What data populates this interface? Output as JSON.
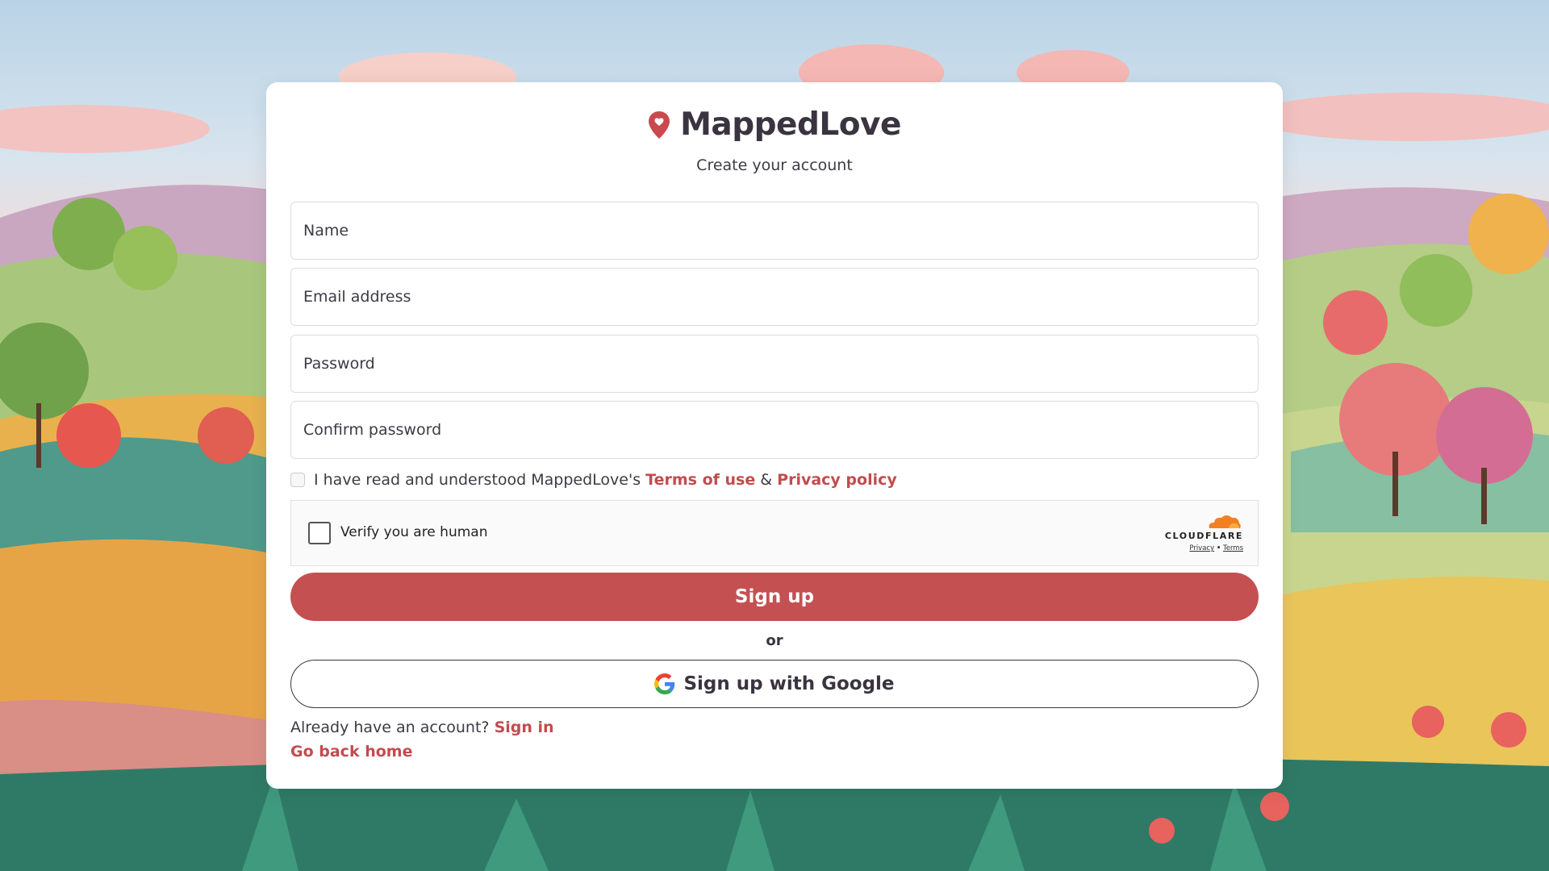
{
  "brand": {
    "name": "MappedLove",
    "accent_color": "#c24c4f"
  },
  "form": {
    "subtitle": "Create your account",
    "name_placeholder": "Name",
    "email_placeholder": "Email address",
    "password_placeholder": "Password",
    "confirm_placeholder": "Confirm password",
    "terms_prefix": "I have read and understood MappedLove's",
    "terms_link": "Terms of use",
    "terms_amp": "&",
    "privacy_link": "Privacy policy"
  },
  "captcha": {
    "label": "Verify you are human",
    "provider": "CLOUDFLARE",
    "privacy": "Privacy",
    "separator": "•",
    "terms": "Terms"
  },
  "actions": {
    "signup_label": "Sign up",
    "or_label": "or",
    "google_label": "Sign up with Google",
    "have_account": "Already have an account?",
    "signin_link": "Sign in",
    "go_home": "Go back home"
  }
}
